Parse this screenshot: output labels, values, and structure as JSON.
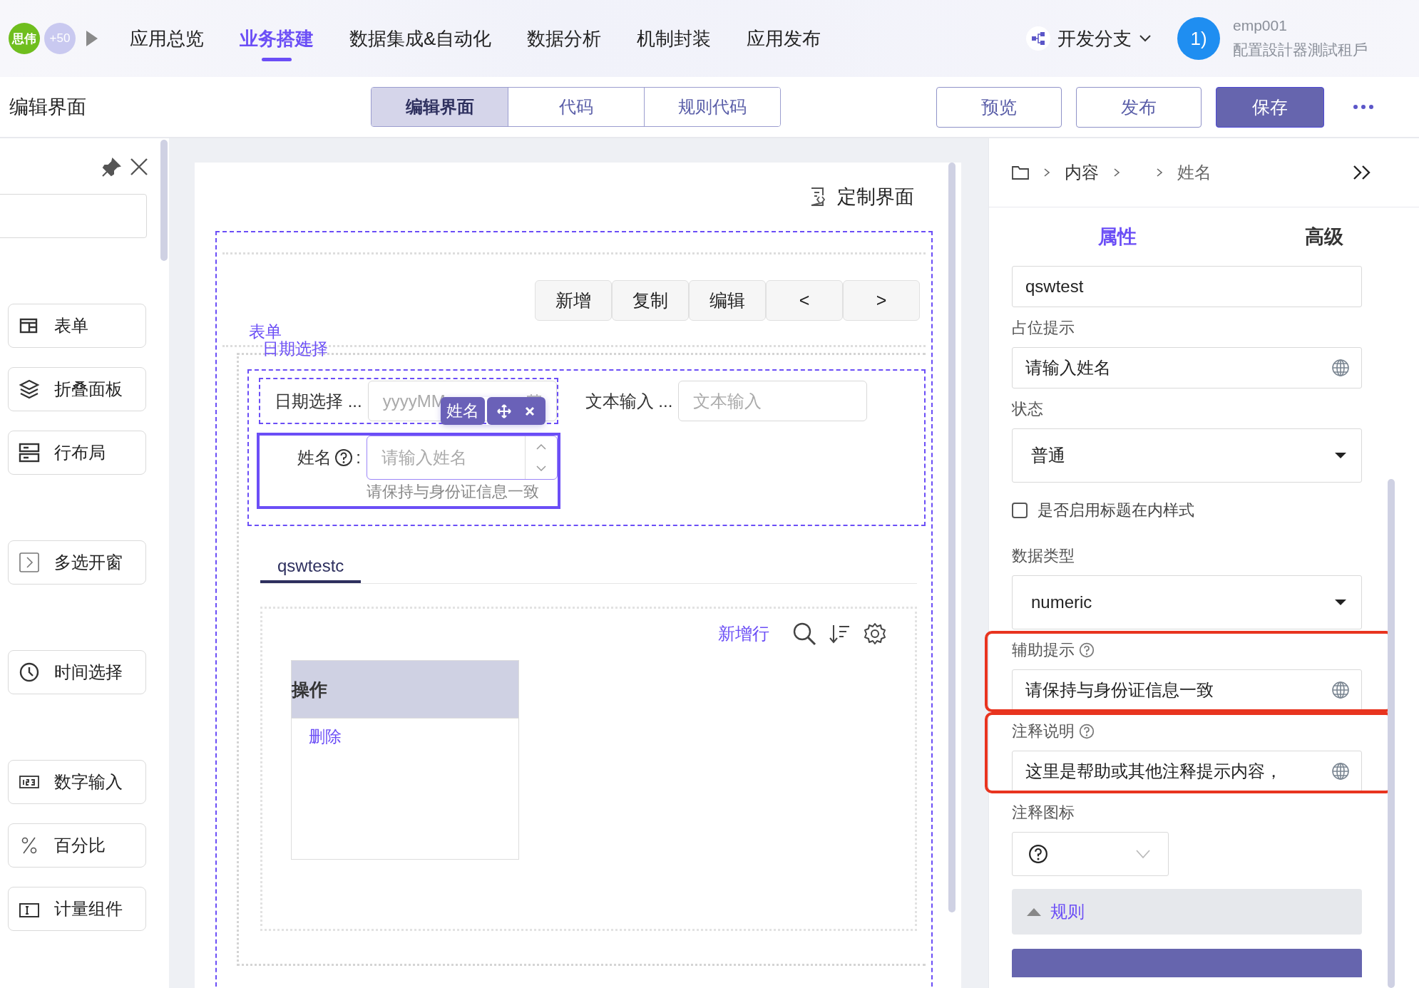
{
  "top_nav": {
    "org_badge": "思伟",
    "member_count": "+50",
    "menu": [
      {
        "label": "应用总览",
        "selected": false
      },
      {
        "label": "业务搭建",
        "selected": true
      },
      {
        "label": "数据集成&自动化",
        "selected": false
      },
      {
        "label": "数据分析",
        "selected": false
      },
      {
        "label": "机制封装",
        "selected": false
      },
      {
        "label": "应用发布",
        "selected": false
      }
    ],
    "branch": "开发分支",
    "user": {
      "avatar_text": "1)",
      "name": "emp001",
      "tenant": "配置設計器測試租戶"
    }
  },
  "toolbar": {
    "title": "编辑界面",
    "view_tabs": [
      {
        "label": "编辑界面",
        "selected": true
      },
      {
        "label": "代码",
        "selected": false
      },
      {
        "label": "规则代码",
        "selected": false
      }
    ],
    "buttons": [
      {
        "label": "预览",
        "kind": "outline"
      },
      {
        "label": "发布",
        "kind": "outline"
      },
      {
        "label": "保存",
        "kind": "primary"
      }
    ]
  },
  "component_panel": {
    "groups": [
      {
        "items": [
          {
            "label": "表单",
            "kind": "form"
          },
          {
            "label": "折叠面板",
            "kind": "collapse"
          },
          {
            "label": "行布局",
            "kind": "rows"
          }
        ]
      },
      {
        "items": [
          {
            "label": "多选开窗",
            "kind": "dialog"
          }
        ]
      },
      {
        "items": [
          {
            "label": "时间选择",
            "kind": "time"
          }
        ]
      },
      {
        "items": [
          {
            "label": "数字输入",
            "kind": "number"
          },
          {
            "label": "百分比",
            "kind": "percent"
          },
          {
            "label": "计量组件",
            "kind": "meter"
          }
        ]
      }
    ]
  },
  "canvas": {
    "custom_button": "定制界面",
    "actions": [
      "新增",
      "复制",
      "编辑",
      "<",
      ">"
    ],
    "form_title": "表单",
    "group_title": "日期选择",
    "fields": [
      {
        "label": "日期选择 ...",
        "placeholder": "yyyyMM",
        "kind": "date"
      },
      {
        "label": "文本输入 ...",
        "placeholder": "文本输入",
        "kind": "text"
      }
    ],
    "selected_field": {
      "label": "姓名",
      "separator": ":",
      "placeholder": "请输入姓名",
      "helper": "请保持与身份证信息一致",
      "tag": "姓名"
    },
    "subtable": {
      "tabs": [
        {
          "label": "qswtestc",
          "selected": true
        }
      ],
      "add_row": "新增行",
      "columns": [
        "操作"
      ],
      "rows": [
        [
          "删除"
        ]
      ]
    }
  },
  "properties": {
    "breadcrumb": [
      {
        "kind": "text",
        "label": "内容"
      },
      {
        "kind": "empty"
      },
      {
        "kind": "current",
        "label": "姓名"
      }
    ],
    "tabs": [
      {
        "label": "属性",
        "selected": true
      },
      {
        "label": "高级",
        "selected": false
      }
    ],
    "fields": [
      {
        "kind": "input",
        "value": "qswtest"
      },
      {
        "kind": "input",
        "label": "占位提示",
        "value": "请输入姓名",
        "i18n": true
      },
      {
        "kind": "select",
        "label": "状态",
        "value": "普通"
      },
      {
        "kind": "checkbox",
        "label": "是否启用标题在内样式",
        "checked": false
      },
      {
        "kind": "select",
        "label": "数据类型",
        "value": "numeric"
      },
      {
        "kind": "input",
        "label": "辅助提示",
        "value": "请保持与身份证信息一致",
        "i18n": true,
        "help": true,
        "highlighted": true
      },
      {
        "kind": "input",
        "label": "注释说明",
        "value": "这里是帮助或其他注释提示内容，",
        "i18n": true,
        "help": true,
        "highlighted": true
      },
      {
        "kind": "icon_select",
        "label": "注释图标"
      }
    ],
    "rules_section": {
      "label": "规则",
      "expanded": false
    }
  }
}
